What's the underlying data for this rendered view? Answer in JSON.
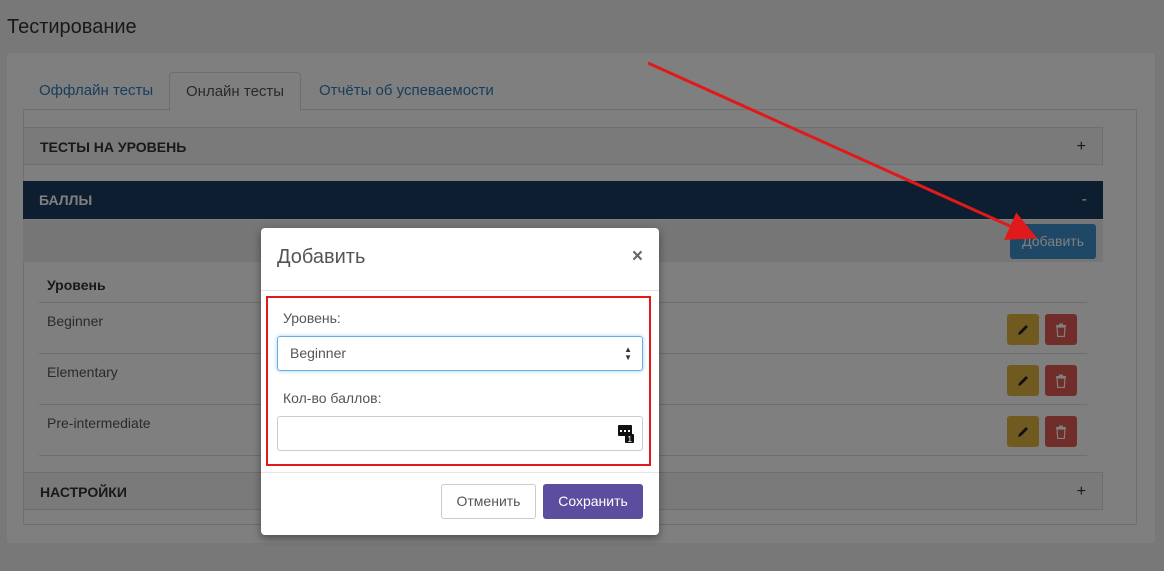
{
  "page": {
    "title": "Тестирование"
  },
  "tabs": [
    {
      "label": "Оффлайн тесты",
      "active": false
    },
    {
      "label": "Онлайн тесты",
      "active": true
    },
    {
      "label": "Отчёты об успеваемости",
      "active": false
    }
  ],
  "accordion": {
    "levels_tests": {
      "label": "ТЕСТЫ НА УРОВЕНЬ",
      "toggle": "+"
    },
    "scores": {
      "label": "БАЛЛЫ",
      "toggle": "-"
    },
    "settings": {
      "label": "НАСТРОЙКИ",
      "toggle": "+"
    }
  },
  "scores": {
    "add_button": "Добавить",
    "column_header": "Уровень",
    "rows": [
      {
        "level": "Beginner"
      },
      {
        "level": "Elementary"
      },
      {
        "level": "Pre-intermediate"
      }
    ]
  },
  "modal": {
    "title": "Добавить",
    "close": "×",
    "level_label": "Уровень:",
    "level_value": "Beginner",
    "score_label": "Кол-во баллов:",
    "score_value": "",
    "cancel": "Отменить",
    "save": "Сохранить"
  },
  "colors": {
    "accent_header": "#1d3d63",
    "add_button": "#3e8ecd",
    "save_button": "#5c4d9e",
    "edit_button": "#e0b440",
    "delete_button": "#e05a52",
    "highlight": "#e01a1a"
  }
}
